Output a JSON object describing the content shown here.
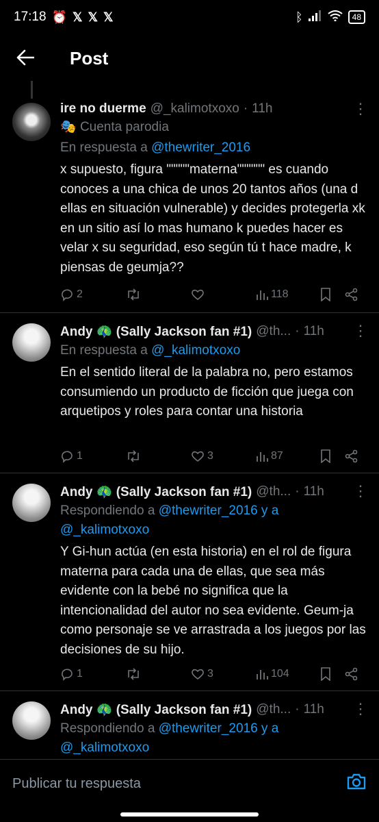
{
  "status_bar": {
    "time": "17:18",
    "left_icons": [
      "alarm-icon",
      "x-icon",
      "x-icon",
      "x-icon"
    ],
    "right_icons": [
      "bluetooth-icon",
      "signal-icon",
      "wifi-icon"
    ],
    "battery": "48"
  },
  "header": {
    "title": "Post"
  },
  "tweets": [
    {
      "name": "ire no duerme",
      "handle": "@_kalimotxoxo",
      "dot": "·",
      "time": "11h",
      "parody": "Cuenta parodia",
      "reply_prefix": "En respuesta a",
      "reply_to": "@thewriter_2016",
      "text": "x supuesto, figura \"\"\"\"\"materna\"\"\"\"\"\" es cuando conoces a una chica de unos 20 tantos años (una d ellas en situación vulnerable) y decides protegerla xk en un sitio así lo mas humano k puedes hacer es velar x su seguridad, eso según tú t hace madre, k piensas de geumja??",
      "replies": "2",
      "retweets": "",
      "likes": "",
      "views": "118"
    },
    {
      "name": "Andy 🦚 (Sally Jackson fan #1)",
      "handle": "@th...",
      "dot": "·",
      "time": "11h",
      "reply_prefix": "En respuesta a",
      "reply_to": "@_kalimotxoxo",
      "text": "En el sentido literal de la palabra no, pero estamos consumiendo un producto de ficción que juega con arquetipos y roles para contar una historia",
      "replies": "1",
      "retweets": "",
      "likes": "3",
      "views": "87"
    },
    {
      "name": "Andy 🦚 (Sally Jackson fan #1)",
      "handle": "@th...",
      "dot": "·",
      "time": "11h",
      "reply_prefix": "Respondiendo a",
      "reply_to": "@thewriter_2016 y a @_kalimotxoxo",
      "text": "Y Gi-hun actúa (en esta historia) en el rol de figura materna para cada una de ellas, que sea más evidente con la bebé no significa que la intencionalidad del autor no sea evidente. Geum-ja como personaje se ve arrastrada a los juegos por las decisiones de su hijo.",
      "replies": "1",
      "retweets": "",
      "likes": "3",
      "views": "104"
    },
    {
      "name": "Andy 🦚 (Sally Jackson fan #1)",
      "handle": "@th...",
      "dot": "·",
      "time": "11h",
      "reply_prefix": "Respondiendo a",
      "reply_to": "@thewriter_2016 y a @_kalimotxoxo"
    }
  ],
  "reply_bar": {
    "placeholder": "Publicar tu respuesta"
  },
  "colors": {
    "background": "#000000",
    "text": "#e7e9ea",
    "muted": "#71767b",
    "link": "#1d9bf0",
    "divider": "#2f3336"
  }
}
